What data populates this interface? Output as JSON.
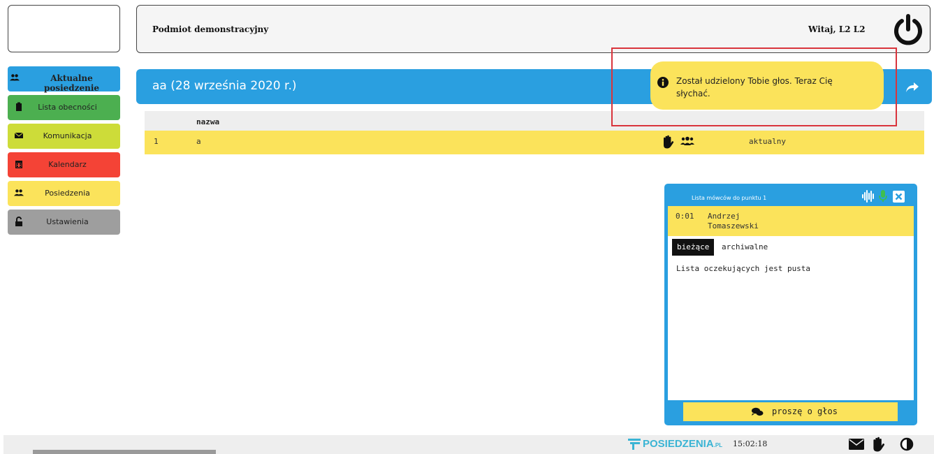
{
  "header": {
    "org_name": "Podmiot demonstracyjny",
    "welcome": "Witaj, L2 L2"
  },
  "sidebar": {
    "items": [
      {
        "label": "Aktualne posiedzenie",
        "icon": "users-icon",
        "color": "#2a9fe0"
      },
      {
        "label": "Lista obecności",
        "icon": "clipboard-icon",
        "color": "#4caf50"
      },
      {
        "label": "Komunikacja",
        "icon": "envelope-icon",
        "color": "#cddc39"
      },
      {
        "label": "Kalendarz",
        "icon": "calendar-icon",
        "color": "#f44336"
      },
      {
        "label": "Posiedzenia",
        "icon": "users-icon",
        "color": "#fbe35b"
      },
      {
        "label": "Ustawienia",
        "icon": "unlock-icon",
        "color": "#9e9e9e"
      }
    ]
  },
  "meeting": {
    "title": "aa (28 września 2020 r.)"
  },
  "agenda": {
    "column_name": "nazwa",
    "rows": [
      {
        "number": "1",
        "name": "a",
        "status": "aktualny"
      }
    ]
  },
  "toast": {
    "message": "Został udzielony Tobie głos. Teraz Cię słychać."
  },
  "speakers": {
    "title": "Lista mówców do punktu 1",
    "current_time": "0:01",
    "current_name": "Andrzej\nTomaszewski",
    "current_name_first": "Andrzej",
    "current_name_last": "Tomaszewski",
    "tab_current": "bieżące",
    "tab_archive": "archiwalne",
    "empty_text": "Lista oczekujących jest pusta",
    "request_button": "proszę o głos"
  },
  "footer": {
    "brand": "POSIEDZENIA",
    "brand_suffix": ".PL",
    "clock": "15:02:18"
  },
  "colors": {
    "accent_blue": "#2a9fe0",
    "highlight_yellow": "#fbe35b",
    "annotation_red": "#d9343c",
    "brand_teal": "#3ab4d4"
  }
}
